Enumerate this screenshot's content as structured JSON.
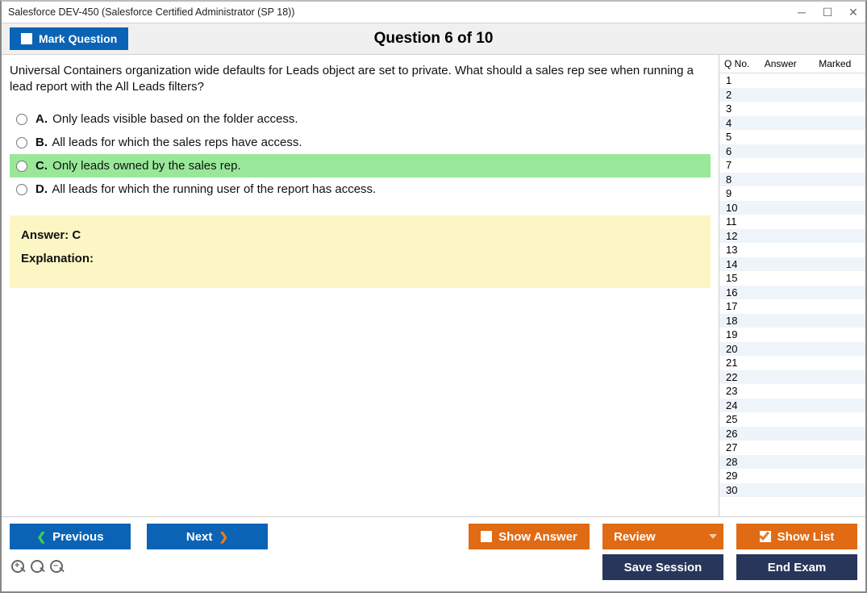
{
  "window": {
    "title": "Salesforce DEV-450 (Salesforce Certified Administrator (SP 18))"
  },
  "toolbar": {
    "mark_label": "Mark Question",
    "question_heading": "Question 6 of 10"
  },
  "question": {
    "text": "Universal Containers organization wide defaults for Leads object are set to private. What should a sales rep see when running a lead report with the All Leads filters?",
    "options": [
      {
        "letter": "A.",
        "text": "Only leads visible based on the folder access.",
        "correct": false
      },
      {
        "letter": "B.",
        "text": "All leads for which the sales reps have access.",
        "correct": false
      },
      {
        "letter": "C.",
        "text": "Only leads owned by the sales rep.",
        "correct": true
      },
      {
        "letter": "D.",
        "text": "All leads for which the running user of the report has access.",
        "correct": false
      }
    ],
    "answer_line": "Answer: C",
    "explanation_label": "Explanation:"
  },
  "panel": {
    "headers": {
      "qno": "Q No.",
      "answer": "Answer",
      "marked": "Marked"
    },
    "total": 30
  },
  "footer": {
    "previous": "Previous",
    "next": "Next",
    "show_answer": "Show Answer",
    "review": "Review",
    "show_list": "Show List",
    "save_session": "Save Session",
    "end_exam": "End Exam"
  }
}
